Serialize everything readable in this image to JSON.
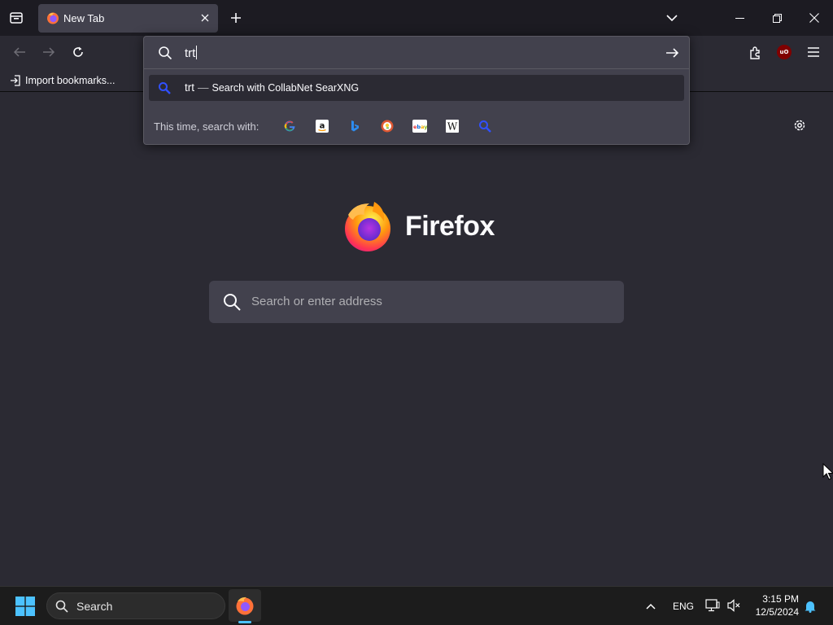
{
  "window": {
    "tab": {
      "title": "New Tab",
      "favicon": "firefox-icon"
    },
    "controls": [
      "minimize-icon",
      "restore-icon",
      "close-icon"
    ]
  },
  "toolbar": {
    "back": "back-arrow-icon",
    "forward": "forward-arrow-icon",
    "reload": "reload-icon",
    "extensions": "puzzle-icon",
    "ublock_label": "uO",
    "menu": "hamburger-icon"
  },
  "bookmarks": {
    "import_label": "Import bookmarks..."
  },
  "urlbar": {
    "value": "trt",
    "result": {
      "query": "trt",
      "separator": "—",
      "action": "Search with CollabNet SearXNG"
    },
    "oneoff_label": "This time, search with:",
    "engines": [
      "Google",
      "Amazon",
      "Bing",
      "DuckDuckGo",
      "eBay",
      "Wikipedia",
      "CollabNet SearXNG"
    ]
  },
  "newtab": {
    "brand": "Firefox",
    "search_placeholder": "Search or enter address"
  },
  "taskbar": {
    "search_label": "Search",
    "language": "ENG",
    "time": "3:15 PM",
    "date": "12/5/2024"
  },
  "colors": {
    "accent": "#4cc2ff",
    "searxng_blue": "#3050ff",
    "content_bg": "#2b2a33",
    "field_bg": "#42414d"
  }
}
